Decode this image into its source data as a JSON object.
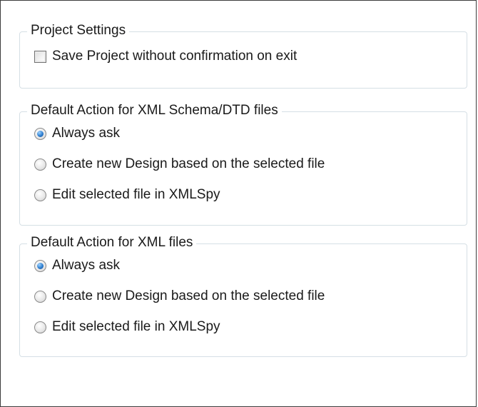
{
  "project_settings": {
    "legend": "Project Settings",
    "save_without_confirmation": {
      "label": "Save Project without confirmation on exit",
      "checked": false
    }
  },
  "schema_dtd_action": {
    "legend": "Default Action for XML Schema/DTD files",
    "options": [
      {
        "label": "Always ask",
        "selected": true
      },
      {
        "label": "Create new Design based on the selected file",
        "selected": false
      },
      {
        "label": "Edit selected file in XMLSpy",
        "selected": false
      }
    ]
  },
  "xml_action": {
    "legend": "Default Action for XML files",
    "options": [
      {
        "label": "Always ask",
        "selected": true
      },
      {
        "label": "Create new Design based on the selected file",
        "selected": false
      },
      {
        "label": "Edit selected file in XMLSpy",
        "selected": false
      }
    ]
  },
  "colors": {
    "group_border": "#d5dfe5",
    "radio_selected": "#2f7fd0",
    "window_border": "#3c3c3c"
  }
}
